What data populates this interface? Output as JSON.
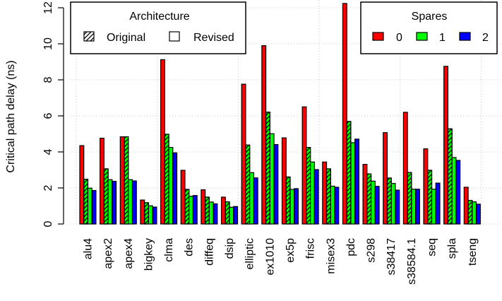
{
  "chart_data": {
    "type": "bar",
    "title": "",
    "xlabel": "",
    "ylabel": "Critical path delay (ns)",
    "ylim": [
      0,
      12
    ],
    "yticks": [
      "0",
      "2",
      "4",
      "6",
      "8",
      "10",
      "12"
    ],
    "grid": true,
    "categories": [
      "alu4",
      "apex2",
      "apex4",
      "bigkey",
      "clma",
      "des",
      "diffeq",
      "dsip",
      "elliptic",
      "ex1010",
      "ex5p",
      "frisc",
      "misex3",
      "pdc",
      "s298",
      "s38417",
      "s38584.1",
      "seq",
      "spla",
      "tseng"
    ],
    "series": [
      {
        "name": "0 spares",
        "architecture": "Original/Revised",
        "spares": "0",
        "color": "#ff0000",
        "hatched": false,
        "values": [
          4.35,
          4.76,
          4.84,
          1.33,
          9.12,
          2.98,
          1.9,
          1.49,
          7.76,
          9.9,
          4.78,
          6.5,
          3.44,
          12.24,
          3.31,
          5.07,
          6.2,
          4.17,
          8.75,
          2.04
        ]
      },
      {
        "name": "1 spare, Original",
        "architecture": "Original",
        "spares": "1",
        "color": "#00ff00",
        "hatched": true,
        "values": [
          2.48,
          3.06,
          4.84,
          1.18,
          4.98,
          1.92,
          1.49,
          1.23,
          4.38,
          6.21,
          2.61,
          4.25,
          3.06,
          5.69,
          2.78,
          2.55,
          2.86,
          2.98,
          5.28,
          1.31
        ]
      },
      {
        "name": "1 spare, Revised",
        "architecture": "Revised",
        "spares": "1",
        "color": "#00ff00",
        "hatched": false,
        "values": [
          1.99,
          2.46,
          2.46,
          1.01,
          4.25,
          1.54,
          1.22,
          0.93,
          2.85,
          5.01,
          1.92,
          3.44,
          2.1,
          4.51,
          2.38,
          2.25,
          1.93,
          1.93,
          3.69,
          1.23
        ]
      },
      {
        "name": "2 spares, Revised",
        "architecture": "Revised",
        "spares": "2",
        "color": "#0000ff",
        "hatched": false,
        "values": [
          1.86,
          2.37,
          2.39,
          0.94,
          3.95,
          1.58,
          1.12,
          0.97,
          2.56,
          4.41,
          1.96,
          3.02,
          2.04,
          4.71,
          2.09,
          1.88,
          1.93,
          2.27,
          3.53,
          1.1
        ]
      }
    ],
    "legends": {
      "architecture": {
        "title": "Architecture",
        "entries": [
          {
            "label": "Original",
            "hatched": true
          },
          {
            "label": "Revised",
            "hatched": false
          }
        ],
        "placement": "top-left"
      },
      "spares": {
        "title": "Spares",
        "entries": [
          {
            "label": "0",
            "color": "#ff0000"
          },
          {
            "label": "1",
            "color": "#00ff00"
          },
          {
            "label": "2",
            "color": "#0000ff"
          }
        ],
        "placement": "top-right"
      }
    }
  }
}
